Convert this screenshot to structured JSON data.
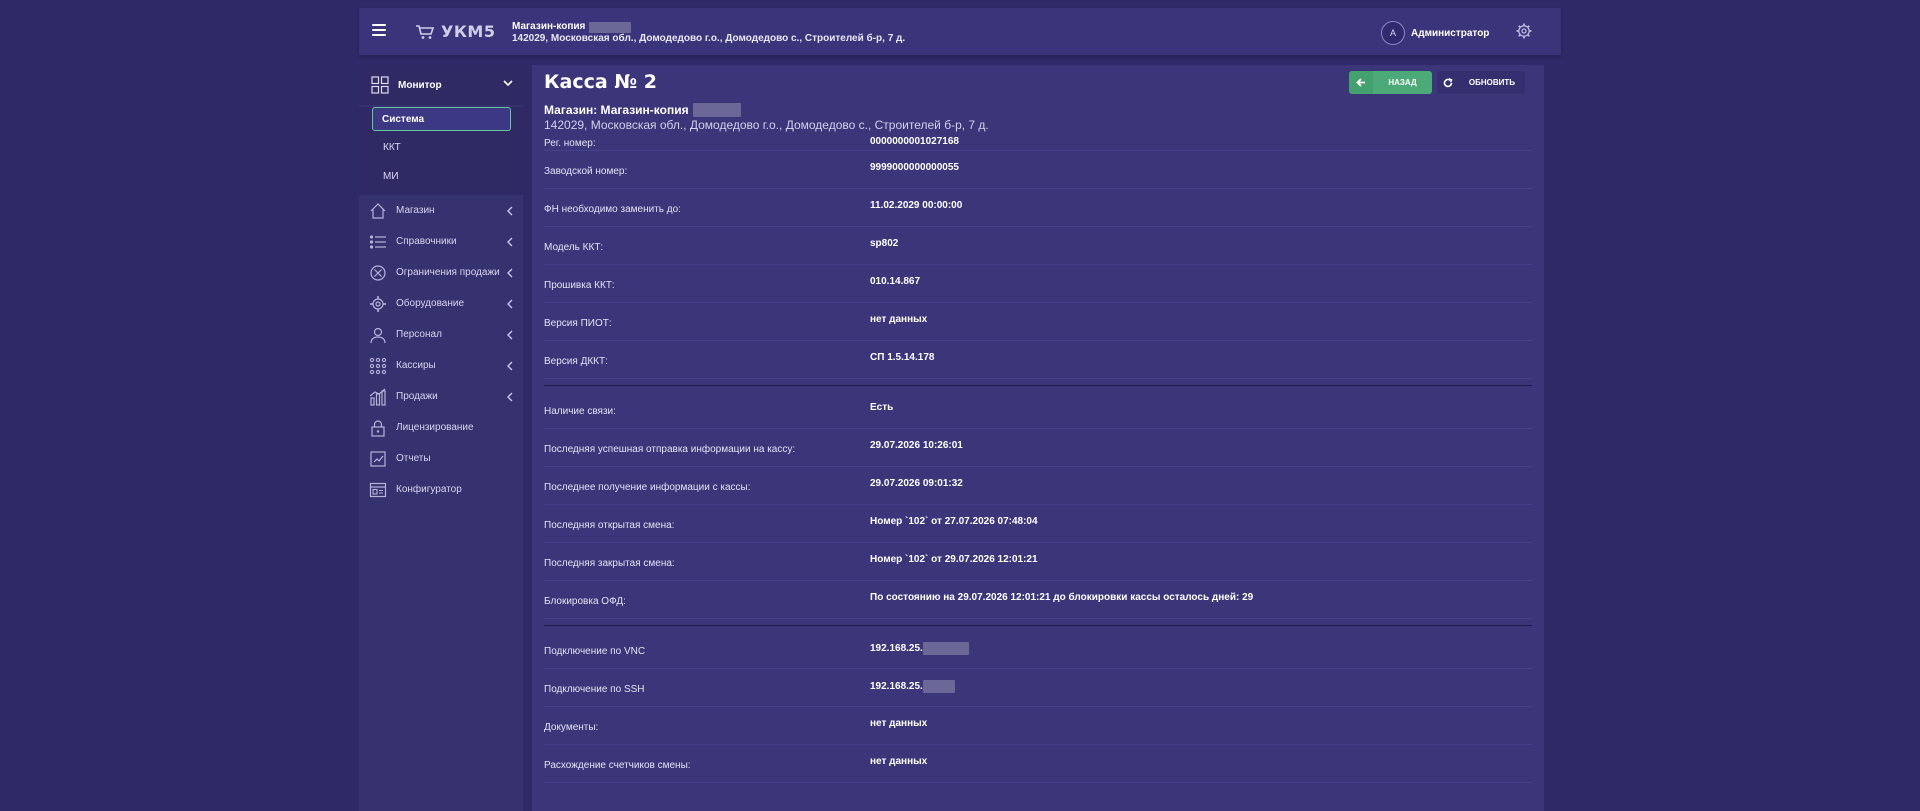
{
  "topbar": {
    "logo": "УКМ5",
    "store_name": "Магазин-копия",
    "store_address": "142029, Московская обл., Домодедово г.о., Домодедово с., Строителей б-р, 7 д.",
    "user_initial": "А",
    "user_name": "Администратор"
  },
  "sidebar": {
    "monitor_label": "Монитор",
    "sub_items": [
      "Система",
      "ККТ",
      "МИ"
    ],
    "items": [
      {
        "label": "Магазин",
        "icon": "home-icon",
        "arrow": true
      },
      {
        "label": "Справочники",
        "icon": "list-icon",
        "arrow": true
      },
      {
        "label": "Ограничения продажи",
        "icon": "restrict-icon",
        "arrow": true
      },
      {
        "label": "Оборудование",
        "icon": "equipment-icon",
        "arrow": true
      },
      {
        "label": "Персонал",
        "icon": "user-icon",
        "arrow": true
      },
      {
        "label": "Кассиры",
        "icon": "grid-dots-icon",
        "arrow": true
      },
      {
        "label": "Продажи",
        "icon": "chart-icon",
        "arrow": true
      },
      {
        "label": "Лицензирование",
        "icon": "lock-icon",
        "arrow": false
      },
      {
        "label": "Отчеты",
        "icon": "report-icon",
        "arrow": false
      },
      {
        "label": "Конфигуратор",
        "icon": "config-icon",
        "arrow": false
      }
    ]
  },
  "main": {
    "title": "Касса № 2",
    "back_label": "НАЗАД",
    "refresh_label": "ОБНОВИТЬ",
    "shop_title": "Магазин: Магазин-копия",
    "shop_address": "142029, Московская обл., Домодедово г.о., Домодедово с., Строителей б-р, 7 д.",
    "group1": [
      {
        "label": "Рег. номер:",
        "value": "0000000001027168"
      },
      {
        "label": "Заводской номер:",
        "value": "9999000000000055"
      },
      {
        "label": "ФН необходимо заменить до:",
        "value": "11.02.2029 00:00:00"
      },
      {
        "label": "Модель ККТ:",
        "value": "sp802"
      },
      {
        "label": "Прошивка ККТ:",
        "value": "010.14.867"
      },
      {
        "label": "Версия ПИОТ:",
        "value": "нет данных"
      },
      {
        "label": "Версия ДККТ:",
        "value": "СП 1.5.14.178"
      }
    ],
    "group2": [
      {
        "label": "Наличие связи:",
        "value": "Есть"
      },
      {
        "label": "Последняя успешная отправка информации на кассу:",
        "value": "29.07.2026 10:26:01"
      },
      {
        "label": "Последнее получение информации с кассы:",
        "value": "29.07.2026 09:01:32"
      },
      {
        "label": "Последняя открытая смена:",
        "value": "Номер `102` от 27.07.2026 07:48:04"
      },
      {
        "label": "Последняя закрытая смена:",
        "value": "Номер `102` от 29.07.2026 12:01:21"
      },
      {
        "label": "Блокировка ОФД:",
        "value": "По состоянию на 29.07.2026 12:01:21 до блокировки кассы осталось дней: 29"
      }
    ],
    "group3": [
      {
        "label": "Подключение по VNC",
        "value": "192.168.25."
      },
      {
        "label": "Подключение по SSH",
        "value": "192.168.25."
      },
      {
        "label": "Документы:",
        "value": "нет данных"
      },
      {
        "label": "Расхождение счетчиков смены:",
        "value": "нет данных"
      }
    ]
  }
}
